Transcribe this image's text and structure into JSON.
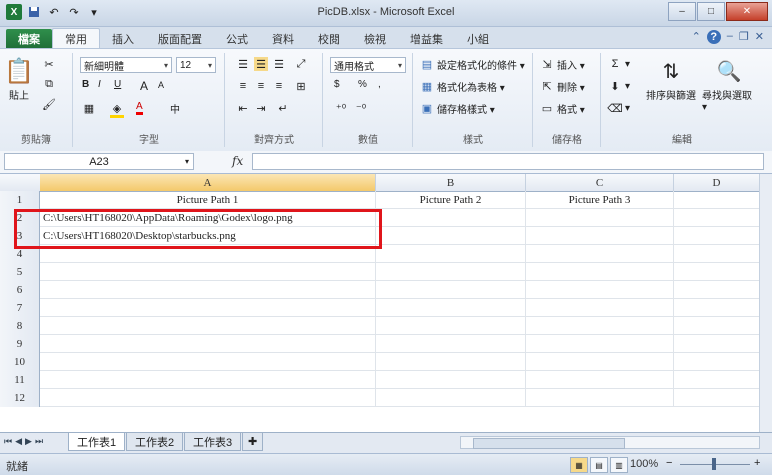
{
  "window": {
    "title": "PicDB.xlsx - Microsoft Excel",
    "controls": {
      "minimize": "–",
      "maximize": "□",
      "close": "✕"
    }
  },
  "quick_access": [
    "save-icon",
    "undo-icon",
    "redo-icon",
    "customize-icon"
  ],
  "ribbon_tabs": {
    "file": "檔案",
    "tabs": [
      "常用",
      "插入",
      "版面配置",
      "公式",
      "資料",
      "校閱",
      "檢視",
      "增益集",
      "小組"
    ],
    "active_index": 0,
    "help": "?"
  },
  "ribbon": {
    "clipboard": {
      "paste": "貼上",
      "label": "剪貼簿"
    },
    "font": {
      "name": "新細明體",
      "size": "12",
      "label": "字型",
      "bold": "B",
      "italic": "I",
      "underline": "U",
      "grow": "A",
      "shrink": "A",
      "color": "A",
      "phonetic": "中"
    },
    "alignment": {
      "label": "對齊方式"
    },
    "number": {
      "format": "通用格式",
      "currency": "$",
      "percent": "%",
      "comma": ",",
      "label": "數值"
    },
    "styles": {
      "conditional": "設定格式化的條件 ▾",
      "table": "格式化為表格 ▾",
      "cell": "儲存格樣式 ▾",
      "label": "樣式"
    },
    "cells": {
      "insert": "插入 ▾",
      "delete": "刪除 ▾",
      "format": "格式 ▾",
      "label": "儲存格"
    },
    "editing": {
      "sort": "排序與篩選",
      "find": "尋找與選取 ▾",
      "label": "編輯"
    }
  },
  "formula_bar": {
    "name_box": "A23",
    "fx": "fx",
    "value": ""
  },
  "columns": [
    "A",
    "B",
    "C",
    "D"
  ],
  "selected_column": "A",
  "rows": [
    {
      "num": "1",
      "cells": [
        "Picture Path 1",
        "Picture Path 2",
        "Picture Path 3",
        ""
      ]
    },
    {
      "num": "2",
      "cells": [
        "C:\\Users\\HT168020\\AppData\\Roaming\\Godex\\logo.png",
        "",
        "",
        ""
      ]
    },
    {
      "num": "3",
      "cells": [
        "C:\\Users\\HT168020\\Desktop\\starbucks.png",
        "",
        "",
        ""
      ]
    },
    {
      "num": "4",
      "cells": [
        "",
        "",
        "",
        ""
      ]
    },
    {
      "num": "5",
      "cells": [
        "",
        "",
        "",
        ""
      ]
    },
    {
      "num": "6",
      "cells": [
        "",
        "",
        "",
        ""
      ]
    },
    {
      "num": "7",
      "cells": [
        "",
        "",
        "",
        ""
      ]
    },
    {
      "num": "8",
      "cells": [
        "",
        "",
        "",
        ""
      ]
    },
    {
      "num": "9",
      "cells": [
        "",
        "",
        "",
        ""
      ]
    },
    {
      "num": "10",
      "cells": [
        "",
        "",
        "",
        ""
      ]
    },
    {
      "num": "11",
      "cells": [
        "",
        "",
        "",
        ""
      ]
    },
    {
      "num": "12",
      "cells": [
        "",
        "",
        "",
        ""
      ]
    }
  ],
  "highlight_color": "#e0151b",
  "sheets": [
    "工作表1",
    "工作表2",
    "工作表3"
  ],
  "active_sheet": 0,
  "status": {
    "mode": "就緒",
    "zoom": "100%",
    "zoom_minus": "−",
    "zoom_plus": "+"
  }
}
